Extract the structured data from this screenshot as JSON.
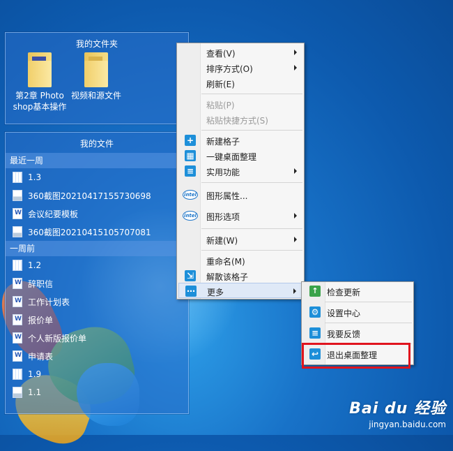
{
  "folders_panel": {
    "title": "我的文件夹",
    "items": [
      {
        "label_line1": "第2章 Photo",
        "label_line2": "shop基本操作"
      },
      {
        "label_line1": "视频和源文件",
        "label_line2": ""
      }
    ]
  },
  "files_panel": {
    "title": "我的文件",
    "sections": [
      {
        "title": "最近一周",
        "items": [
          "1.3",
          "360截图20210417155730698",
          "会议纪要模板",
          "360截图20210415105707081"
        ]
      },
      {
        "title": "一周前",
        "items": [
          "1.2",
          "辞职信",
          "工作计划表",
          "报价单",
          "个人新版报价单",
          "申请表",
          "1.9",
          "1.1"
        ]
      }
    ]
  },
  "context_menu": {
    "items": [
      {
        "label": "查看(V)",
        "submenu": true
      },
      {
        "label": "排序方式(O)",
        "submenu": true
      },
      {
        "label": "刷新(E)"
      },
      {
        "label": "粘贴(P)",
        "disabled": true
      },
      {
        "label": "粘贴快捷方式(S)",
        "disabled": true
      },
      {
        "label": "新建格子"
      },
      {
        "label": "一键桌面整理"
      },
      {
        "label": "实用功能",
        "submenu": true
      },
      {
        "label": "图形属性..."
      },
      {
        "label": "图形选项",
        "submenu": true
      },
      {
        "label": "新建(W)",
        "submenu": true
      },
      {
        "label": "重命名(M)"
      },
      {
        "label": "解散该格子"
      },
      {
        "label": "更多",
        "submenu": true
      }
    ]
  },
  "submenu_more": {
    "items": [
      "检查更新",
      "设置中心",
      "我要反馈",
      "退出桌面整理"
    ]
  },
  "watermark": {
    "brand": "Bai du 经验",
    "url": "jingyan.baidu.com"
  },
  "colors": {
    "highlight_box": "#e0141e",
    "menu_icon_blue": "#1d8fd9",
    "menu_icon_green": "#3aa34a"
  }
}
